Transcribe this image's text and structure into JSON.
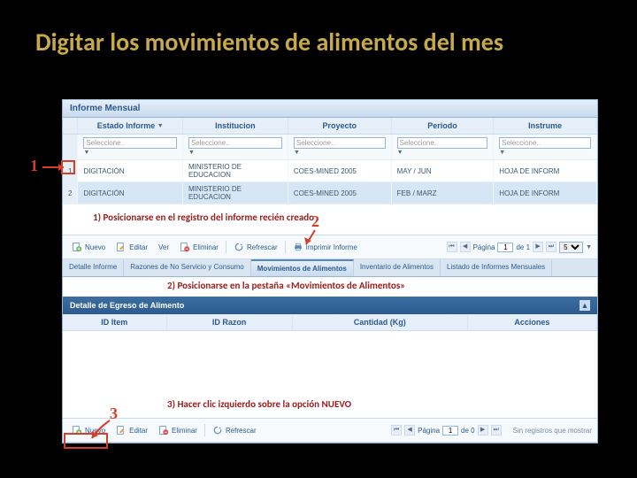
{
  "title": "Digitar los movimientos de alimentos del mes",
  "panelTitle": "Informe Mensual",
  "mainCols": [
    "",
    "Estado Informe",
    "Institucion",
    "Proyecto",
    "Periodo",
    "Instrume"
  ],
  "filterPh": [
    "",
    "Seleccione..",
    "Seleccione..",
    "Seleccione..",
    "Seleccione..",
    "Seleccione.."
  ],
  "rows": [
    {
      "n": "1",
      "estado": "DIGITACIÓN",
      "inst": "MINISTERIO DE EDUCACION",
      "proy": "COES-MINED 2005",
      "per": "MAY / JUN",
      "instr": "HOJA DE INFORM"
    },
    {
      "n": "2",
      "estado": "DIGITACIÓN",
      "inst": "MINISTERIO DE EDUCACION",
      "proy": "COES-MINED 2005",
      "per": "FEB / MARZ",
      "instr": "HOJA DE INFORM"
    }
  ],
  "toolbar": {
    "nuevo": "Nuevo",
    "editar": "Editar",
    "ver": "Ver",
    "eliminar": "Eliminar",
    "refrescar": "Refrescar",
    "imprimir": "Imprimir Informe"
  },
  "pager": {
    "labelPage": "Página",
    "current": "1",
    "of": "de 1",
    "pageSize": "5"
  },
  "tabs": [
    "Detalle Informe",
    "Razones de No Servicio y Consumo",
    "Movimientos de Alimentos",
    "Inventario de Alimentos",
    "Listado de Informes Mensuales"
  ],
  "subTitle": "Detalle de Egreso de Alimento",
  "subCols": [
    "ID Item",
    "ID Razon",
    "Cantidad (Kg)",
    "Acciones"
  ],
  "pager2": {
    "labelPage": "Página",
    "current": "1",
    "of": "de 0",
    "empty": "Sin registros que mostrar"
  },
  "callouts": {
    "c1": "1) Posicionarse en el registro del informe recién creado",
    "c2": "2) Posicionarse en la pestaña «Movimientos de Alimentos»",
    "c3": "3) Hacer clic izquierdo sobre la opción NUEVO"
  },
  "annoNums": {
    "a1": "1",
    "a2": "2",
    "a3": "3"
  }
}
